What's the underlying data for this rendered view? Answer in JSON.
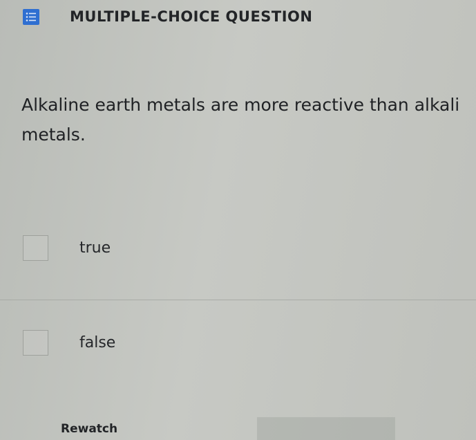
{
  "header": {
    "icon": "list-icon",
    "title": "MULTIPLE-CHOICE QUESTION",
    "accent_color": "#2f6fd1"
  },
  "question": {
    "text": "Alkaline earth metals are more reactive than alkali metals."
  },
  "options": [
    {
      "label": "true",
      "checked": false
    },
    {
      "label": "false",
      "checked": false
    }
  ],
  "footer": {
    "rewatch_label": "Rewatch"
  }
}
